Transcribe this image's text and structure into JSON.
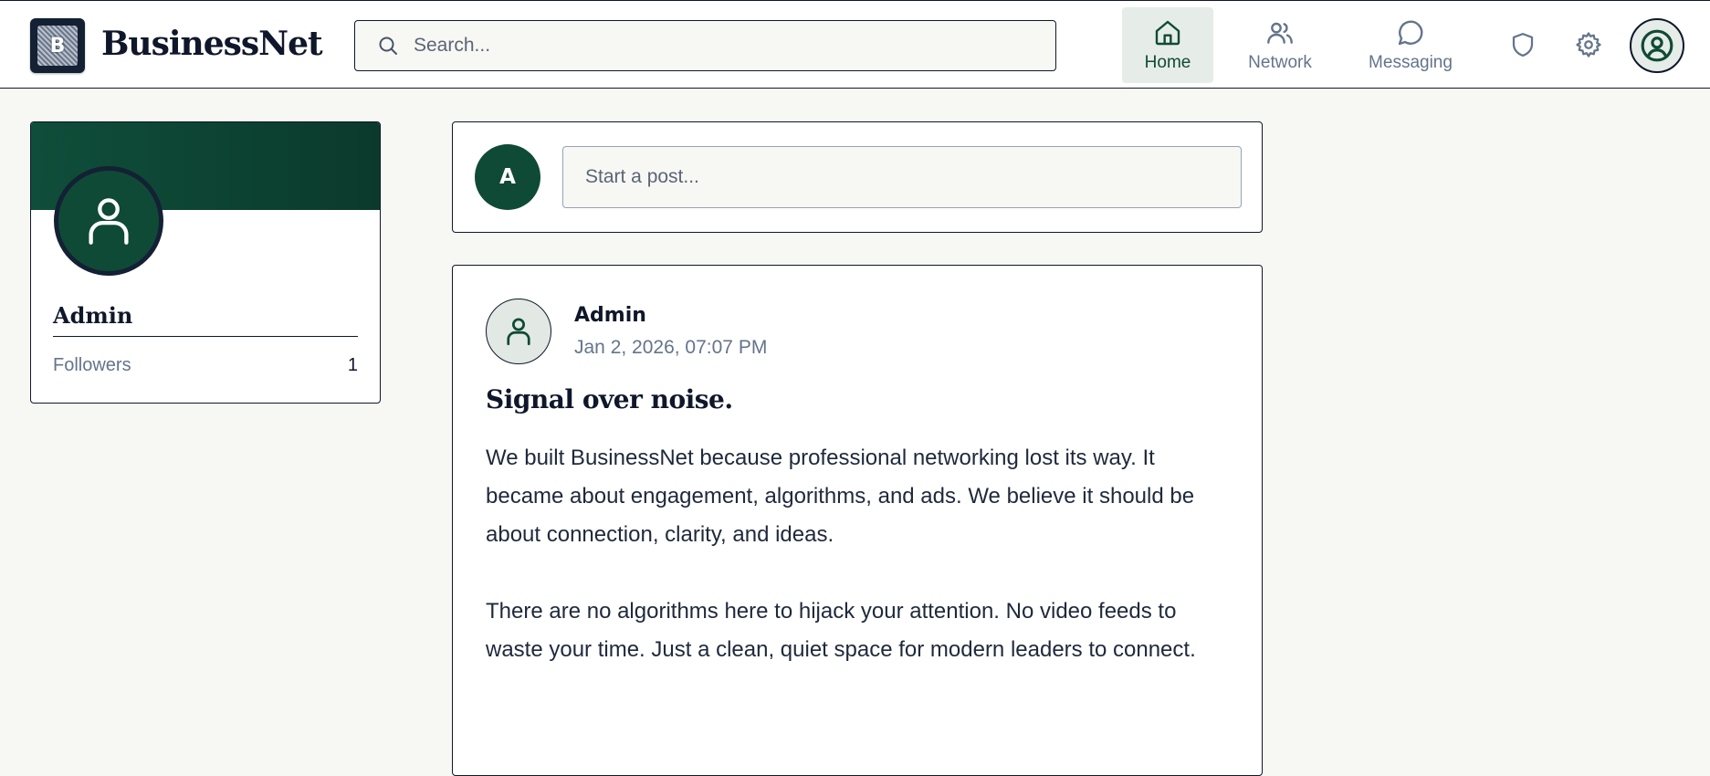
{
  "brand": {
    "logo_letter": "B",
    "name": "BusinessNet"
  },
  "search": {
    "placeholder": "Search...",
    "value": ""
  },
  "nav": {
    "items": [
      {
        "label": "Home",
        "icon": "home-icon",
        "active": true
      },
      {
        "label": "Network",
        "icon": "users-icon",
        "active": false
      },
      {
        "label": "Messaging",
        "icon": "message-icon",
        "active": false
      }
    ],
    "extra_icons": [
      "shield-icon",
      "gear-icon",
      "user-circle-icon"
    ]
  },
  "profile": {
    "name": "Admin",
    "followers_label": "Followers",
    "followers_count": "1",
    "avatar_icon": "user-icon"
  },
  "composer": {
    "avatar_letter": "A",
    "placeholder": "Start a post..."
  },
  "post": {
    "author": "Admin",
    "timestamp": "Jan 2, 2026, 07:07 PM",
    "title": "Signal over noise.",
    "paragraphs": [
      "We built BusinessNet because professional networking lost its way. It became about engagement, algorithms, and ads. We believe it should be about connection, clarity, and ideas.",
      "There are no algorithms here to hijack your attention. No video feeds to waste your time. Just a clean, quiet space for modern leaders to connect."
    ]
  },
  "colors": {
    "accent": "#0f4a37",
    "background": "#f7f7f4",
    "border": "#0f172a",
    "muted_text": "#64748b",
    "active_nav_bg": "#e6ece8"
  }
}
